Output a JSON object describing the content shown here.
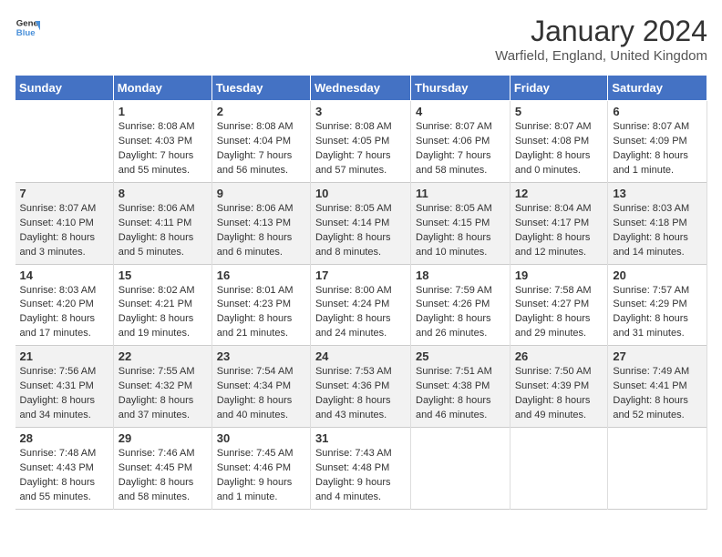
{
  "logo": {
    "line1": "General",
    "line2": "Blue"
  },
  "title": "January 2024",
  "location": "Warfield, England, United Kingdom",
  "days_header": [
    "Sunday",
    "Monday",
    "Tuesday",
    "Wednesday",
    "Thursday",
    "Friday",
    "Saturday"
  ],
  "weeks": [
    [
      {
        "num": "",
        "info": ""
      },
      {
        "num": "1",
        "info": "Sunrise: 8:08 AM\nSunset: 4:03 PM\nDaylight: 7 hours\nand 55 minutes."
      },
      {
        "num": "2",
        "info": "Sunrise: 8:08 AM\nSunset: 4:04 PM\nDaylight: 7 hours\nand 56 minutes."
      },
      {
        "num": "3",
        "info": "Sunrise: 8:08 AM\nSunset: 4:05 PM\nDaylight: 7 hours\nand 57 minutes."
      },
      {
        "num": "4",
        "info": "Sunrise: 8:07 AM\nSunset: 4:06 PM\nDaylight: 7 hours\nand 58 minutes."
      },
      {
        "num": "5",
        "info": "Sunrise: 8:07 AM\nSunset: 4:08 PM\nDaylight: 8 hours\nand 0 minutes."
      },
      {
        "num": "6",
        "info": "Sunrise: 8:07 AM\nSunset: 4:09 PM\nDaylight: 8 hours\nand 1 minute."
      }
    ],
    [
      {
        "num": "7",
        "info": "Sunrise: 8:07 AM\nSunset: 4:10 PM\nDaylight: 8 hours\nand 3 minutes."
      },
      {
        "num": "8",
        "info": "Sunrise: 8:06 AM\nSunset: 4:11 PM\nDaylight: 8 hours\nand 5 minutes."
      },
      {
        "num": "9",
        "info": "Sunrise: 8:06 AM\nSunset: 4:13 PM\nDaylight: 8 hours\nand 6 minutes."
      },
      {
        "num": "10",
        "info": "Sunrise: 8:05 AM\nSunset: 4:14 PM\nDaylight: 8 hours\nand 8 minutes."
      },
      {
        "num": "11",
        "info": "Sunrise: 8:05 AM\nSunset: 4:15 PM\nDaylight: 8 hours\nand 10 minutes."
      },
      {
        "num": "12",
        "info": "Sunrise: 8:04 AM\nSunset: 4:17 PM\nDaylight: 8 hours\nand 12 minutes."
      },
      {
        "num": "13",
        "info": "Sunrise: 8:03 AM\nSunset: 4:18 PM\nDaylight: 8 hours\nand 14 minutes."
      }
    ],
    [
      {
        "num": "14",
        "info": "Sunrise: 8:03 AM\nSunset: 4:20 PM\nDaylight: 8 hours\nand 17 minutes."
      },
      {
        "num": "15",
        "info": "Sunrise: 8:02 AM\nSunset: 4:21 PM\nDaylight: 8 hours\nand 19 minutes."
      },
      {
        "num": "16",
        "info": "Sunrise: 8:01 AM\nSunset: 4:23 PM\nDaylight: 8 hours\nand 21 minutes."
      },
      {
        "num": "17",
        "info": "Sunrise: 8:00 AM\nSunset: 4:24 PM\nDaylight: 8 hours\nand 24 minutes."
      },
      {
        "num": "18",
        "info": "Sunrise: 7:59 AM\nSunset: 4:26 PM\nDaylight: 8 hours\nand 26 minutes."
      },
      {
        "num": "19",
        "info": "Sunrise: 7:58 AM\nSunset: 4:27 PM\nDaylight: 8 hours\nand 29 minutes."
      },
      {
        "num": "20",
        "info": "Sunrise: 7:57 AM\nSunset: 4:29 PM\nDaylight: 8 hours\nand 31 minutes."
      }
    ],
    [
      {
        "num": "21",
        "info": "Sunrise: 7:56 AM\nSunset: 4:31 PM\nDaylight: 8 hours\nand 34 minutes."
      },
      {
        "num": "22",
        "info": "Sunrise: 7:55 AM\nSunset: 4:32 PM\nDaylight: 8 hours\nand 37 minutes."
      },
      {
        "num": "23",
        "info": "Sunrise: 7:54 AM\nSunset: 4:34 PM\nDaylight: 8 hours\nand 40 minutes."
      },
      {
        "num": "24",
        "info": "Sunrise: 7:53 AM\nSunset: 4:36 PM\nDaylight: 8 hours\nand 43 minutes."
      },
      {
        "num": "25",
        "info": "Sunrise: 7:51 AM\nSunset: 4:38 PM\nDaylight: 8 hours\nand 46 minutes."
      },
      {
        "num": "26",
        "info": "Sunrise: 7:50 AM\nSunset: 4:39 PM\nDaylight: 8 hours\nand 49 minutes."
      },
      {
        "num": "27",
        "info": "Sunrise: 7:49 AM\nSunset: 4:41 PM\nDaylight: 8 hours\nand 52 minutes."
      }
    ],
    [
      {
        "num": "28",
        "info": "Sunrise: 7:48 AM\nSunset: 4:43 PM\nDaylight: 8 hours\nand 55 minutes."
      },
      {
        "num": "29",
        "info": "Sunrise: 7:46 AM\nSunset: 4:45 PM\nDaylight: 8 hours\nand 58 minutes."
      },
      {
        "num": "30",
        "info": "Sunrise: 7:45 AM\nSunset: 4:46 PM\nDaylight: 9 hours\nand 1 minute."
      },
      {
        "num": "31",
        "info": "Sunrise: 7:43 AM\nSunset: 4:48 PM\nDaylight: 9 hours\nand 4 minutes."
      },
      {
        "num": "",
        "info": ""
      },
      {
        "num": "",
        "info": ""
      },
      {
        "num": "",
        "info": ""
      }
    ]
  ]
}
